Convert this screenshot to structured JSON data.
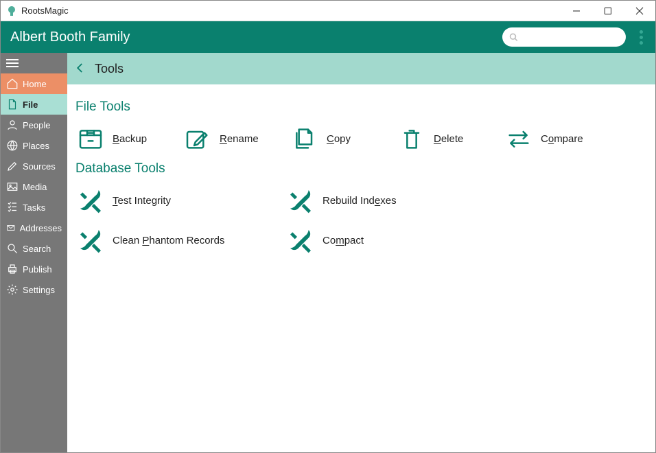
{
  "app_title": "RootsMagic",
  "family_title": "Albert Booth Family",
  "search": {
    "placeholder": ""
  },
  "breadcrumb": {
    "title": "Tools"
  },
  "sidebar": {
    "items": [
      {
        "label": "Home"
      },
      {
        "label": "File"
      },
      {
        "label": "People"
      },
      {
        "label": "Places"
      },
      {
        "label": "Sources"
      },
      {
        "label": "Media"
      },
      {
        "label": "Tasks"
      },
      {
        "label": "Addresses"
      },
      {
        "label": "Search"
      },
      {
        "label": "Publish"
      },
      {
        "label": "Settings"
      }
    ]
  },
  "sections": {
    "file_tools_title": "File Tools",
    "database_tools_title": "Database Tools"
  },
  "file_tools": {
    "backup": {
      "pre": "",
      "u": "B",
      "post": "ackup"
    },
    "rename": {
      "pre": "",
      "u": "R",
      "post": "ename"
    },
    "copy": {
      "pre": "",
      "u": "C",
      "post": "opy"
    },
    "delete": {
      "pre": "",
      "u": "D",
      "post": "elete"
    },
    "compare": {
      "pre": "C",
      "u": "o",
      "post": "mpare"
    }
  },
  "db_tools": {
    "test": {
      "pre": "",
      "u": "T",
      "post": "est Integrity"
    },
    "rebuild": {
      "pre": "Rebuild Ind",
      "u": "e",
      "post": "xes"
    },
    "phantom": {
      "pre": "Clean ",
      "u": "P",
      "post": "hantom Records"
    },
    "compact": {
      "pre": "Co",
      "u": "m",
      "post": "pact"
    }
  },
  "colors": {
    "brand": "#0a806e",
    "accent": "#ec8f66",
    "sidebar": "#777777",
    "crumb_bg": "#a2d9cd"
  }
}
